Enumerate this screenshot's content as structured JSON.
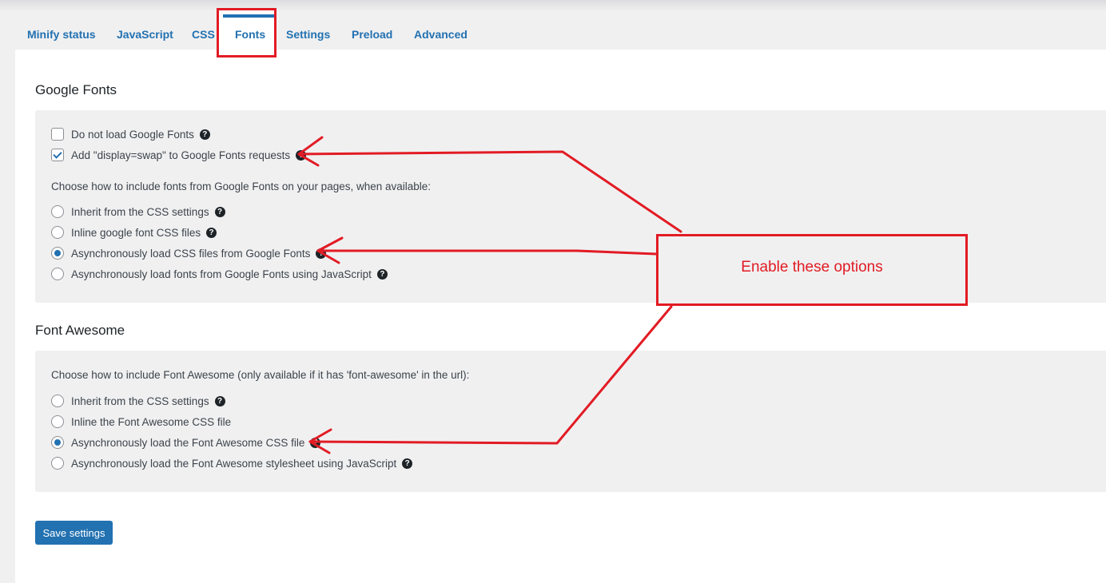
{
  "tabs": [
    {
      "label": "Minify status"
    },
    {
      "label": "JavaScript"
    },
    {
      "label": "CSS"
    },
    {
      "label": "Fonts"
    },
    {
      "label": "Settings"
    },
    {
      "label": "Preload"
    },
    {
      "label": "Advanced"
    }
  ],
  "active_tab": "Fonts",
  "google_fonts": {
    "title": "Google Fonts",
    "checkboxes": [
      {
        "label": "Do not load Google Fonts",
        "checked": false
      },
      {
        "label": "Add \"display=swap\" to Google Fonts requests",
        "checked": true
      }
    ],
    "description": "Choose how to include fonts from Google Fonts on your pages, when available:",
    "options": [
      {
        "label": "Inherit from the CSS settings",
        "selected": false
      },
      {
        "label": "Inline google font CSS files",
        "selected": false
      },
      {
        "label": "Asynchronously load CSS files from Google Fonts",
        "selected": true
      },
      {
        "label": "Asynchronously load fonts from Google Fonts using JavaScript",
        "selected": false
      }
    ]
  },
  "font_awesome": {
    "title": "Font Awesome",
    "description": "Choose how to include Font Awesome (only available if it has 'font-awesome' in the url):",
    "options": [
      {
        "label": "Inherit from the CSS settings",
        "selected": false
      },
      {
        "label": "Inline the Font Awesome CSS file",
        "selected": false
      },
      {
        "label": "Asynchronously load the Font Awesome CSS file",
        "selected": true
      },
      {
        "label": "Asynchronously load the Font Awesome stylesheet using JavaScript",
        "selected": false
      }
    ]
  },
  "help_glyph": "?",
  "save_label": "Save settings",
  "annotation": {
    "text": "Enable these options"
  },
  "colors": {
    "accent": "#2271b1",
    "annotation": "#e21b24"
  }
}
